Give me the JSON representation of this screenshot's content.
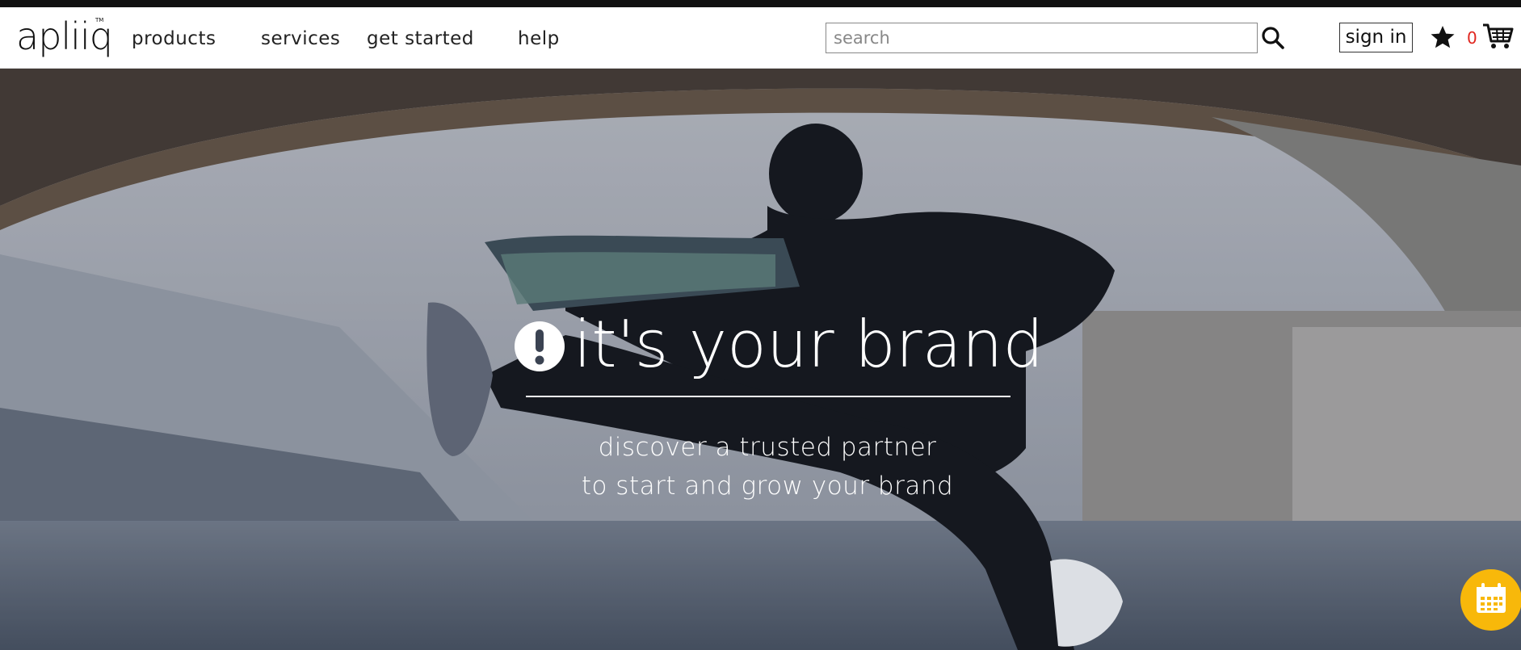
{
  "brand": {
    "logo_text": "apliiq",
    "logo_tm": "TM"
  },
  "nav": {
    "items": [
      {
        "label": "products"
      },
      {
        "label": "services"
      },
      {
        "label": "get started"
      },
      {
        "label": "help"
      }
    ]
  },
  "search": {
    "placeholder": "search",
    "value": ""
  },
  "account": {
    "signin_label": "sign in",
    "cart_count": "0"
  },
  "hero": {
    "headline": "it's your brand",
    "subline_1": "discover a trusted partner",
    "subline_2": "to start and grow your brand"
  },
  "icons": {
    "search": "search-icon",
    "star": "star-icon",
    "cart": "cart-icon",
    "calendar": "calendar-icon",
    "brand_mark": "exclamation-circle-icon"
  },
  "colors": {
    "topbar": "#111111",
    "cart_count": "#e0261f",
    "fab": "#f8b80a",
    "hero_text": "#ffffff"
  }
}
